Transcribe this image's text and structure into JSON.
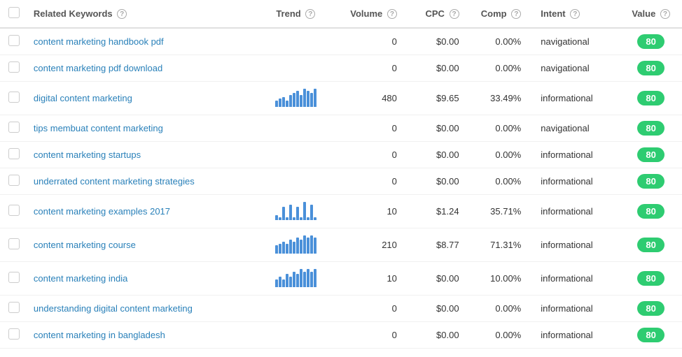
{
  "table": {
    "columns": {
      "check": "",
      "keyword": "Related Keywords",
      "trend": "Trend",
      "volume": "Volume",
      "cpc": "CPC",
      "comp": "Comp",
      "intent": "Intent",
      "value": "Value"
    },
    "rows": [
      {
        "id": 1,
        "keyword": "content marketing handbook pdf",
        "trend": [],
        "volume": "0",
        "cpc": "$0.00",
        "comp": "0.00%",
        "intent": "navigational",
        "value": "80"
      },
      {
        "id": 2,
        "keyword": "content marketing pdf download",
        "trend": [],
        "volume": "0",
        "cpc": "$0.00",
        "comp": "0.00%",
        "intent": "navigational",
        "value": "80"
      },
      {
        "id": 3,
        "keyword": "digital content marketing",
        "trend": [
          3,
          4,
          5,
          3,
          6,
          7,
          8,
          6,
          9,
          8,
          7,
          9
        ],
        "volume": "480",
        "cpc": "$9.65",
        "comp": "33.49%",
        "intent": "informational",
        "value": "80"
      },
      {
        "id": 4,
        "keyword": "tips membuat content marketing",
        "trend": [],
        "volume": "0",
        "cpc": "$0.00",
        "comp": "0.00%",
        "intent": "navigational",
        "value": "80"
      },
      {
        "id": 5,
        "keyword": "content marketing startups",
        "trend": [],
        "volume": "0",
        "cpc": "$0.00",
        "comp": "0.00%",
        "intent": "informational",
        "value": "80"
      },
      {
        "id": 6,
        "keyword": "underrated content marketing strategies",
        "trend": [],
        "volume": "0",
        "cpc": "$0.00",
        "comp": "0.00%",
        "intent": "informational",
        "value": "80"
      },
      {
        "id": 7,
        "keyword": "content marketing examples 2017",
        "trend": [
          2,
          1,
          5,
          1,
          6,
          1,
          5,
          1,
          7,
          1,
          6,
          1
        ],
        "volume": "10",
        "cpc": "$1.24",
        "comp": "35.71%",
        "intent": "informational",
        "value": "80"
      },
      {
        "id": 8,
        "keyword": "content marketing course",
        "trend": [
          4,
          5,
          6,
          5,
          7,
          6,
          8,
          7,
          9,
          8,
          9,
          8
        ],
        "volume": "210",
        "cpc": "$8.77",
        "comp": "71.31%",
        "intent": "informational",
        "value": "80"
      },
      {
        "id": 9,
        "keyword": "content marketing india",
        "trend": [
          3,
          4,
          3,
          5,
          4,
          6,
          5,
          7,
          6,
          7,
          6,
          7
        ],
        "volume": "10",
        "cpc": "$0.00",
        "comp": "10.00%",
        "intent": "informational",
        "value": "80"
      },
      {
        "id": 10,
        "keyword": "understanding digital content marketing",
        "trend": [],
        "volume": "0",
        "cpc": "$0.00",
        "comp": "0.00%",
        "intent": "informational",
        "value": "80"
      },
      {
        "id": 11,
        "keyword": "content marketing in bangladesh",
        "trend": [],
        "volume": "0",
        "cpc": "$0.00",
        "comp": "0.00%",
        "intent": "informational",
        "value": "80"
      }
    ]
  },
  "colors": {
    "badge_green": "#2ecc71",
    "link_blue": "#2980b9",
    "bar_blue": "#4a90d9"
  }
}
